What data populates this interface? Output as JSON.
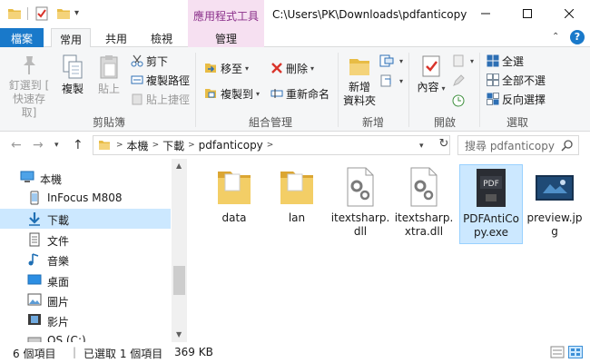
{
  "titlebar": {
    "path": "C:\\Users\\PK\\Downloads\\pdfanticopy",
    "contextual_tab_group": "應用程式工具",
    "dropdown_glyph": "▾"
  },
  "tabs": {
    "file": "檔案",
    "home": "常用",
    "share": "共用",
    "view": "檢視",
    "manage": "管理",
    "collapse_glyph": "⌃",
    "help_glyph": "?"
  },
  "ribbon": {
    "clipboard": {
      "label": "剪貼簿",
      "pin": [
        "釘選到 [",
        "快速存取]"
      ],
      "copy": "複製",
      "paste": "貼上",
      "cut": "剪下",
      "copy_path": "複製路徑",
      "paste_shortcut": "貼上捷徑"
    },
    "organize": {
      "label": "組合管理",
      "move_to": "移至",
      "copy_to": "複製到",
      "delete": "刪除",
      "rename": "重新命名"
    },
    "new": {
      "label": "新增",
      "new_folder": [
        "新增",
        "資料夾"
      ]
    },
    "open": {
      "label": "開啟",
      "properties": "內容"
    },
    "select": {
      "label": "選取",
      "select_all": "全選",
      "select_none": "全部不選",
      "invert": "反向選擇"
    }
  },
  "address": {
    "segments": [
      "本機",
      "下載",
      "pdfanticopy"
    ],
    "search_placeholder": "搜尋 pdfanticopy"
  },
  "nav": {
    "items": [
      {
        "label": "本機",
        "icon": "this-pc-icon"
      },
      {
        "label": "InFocus M808",
        "icon": "phone-icon"
      },
      {
        "label": "下載",
        "icon": "downloads-icon"
      },
      {
        "label": "文件",
        "icon": "documents-icon"
      },
      {
        "label": "音樂",
        "icon": "music-icon"
      },
      {
        "label": "桌面",
        "icon": "desktop-icon"
      },
      {
        "label": "圖片",
        "icon": "pictures-icon"
      },
      {
        "label": "影片",
        "icon": "videos-icon"
      },
      {
        "label": "OS (C:)",
        "icon": "drive-icon"
      }
    ]
  },
  "files": [
    {
      "name": [
        "data"
      ],
      "type": "folder"
    },
    {
      "name": [
        "lan"
      ],
      "type": "folder"
    },
    {
      "name": [
        "itextsharp.",
        "dll"
      ],
      "type": "dll"
    },
    {
      "name": [
        "itextsharp.",
        "xtra.dll"
      ],
      "type": "dll"
    },
    {
      "name": [
        "PDFAntiCo",
        "py.exe"
      ],
      "type": "exe",
      "selected": true
    },
    {
      "name": [
        "preview.jp",
        "g"
      ],
      "type": "image"
    }
  ],
  "status": {
    "item_count": "6 個項目",
    "selection": "已選取 1 個項目",
    "size": "369 KB"
  },
  "colors": {
    "accent": "#1979ca",
    "selection": "#cce8ff",
    "contextual_tab": "#f6e0f1",
    "folder": "#e8bc45"
  }
}
